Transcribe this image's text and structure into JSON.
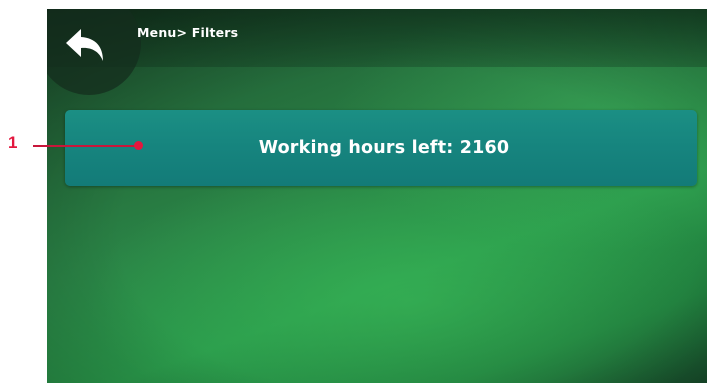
{
  "header": {
    "breadcrumb": "Menu> Filters",
    "back_icon": "back-arrow-icon"
  },
  "main": {
    "info_text": "Working hours left: 2160"
  },
  "annotation": {
    "callout_number": "1",
    "callout_color": "#e3173e"
  },
  "colors": {
    "background_green": "#2a8446",
    "info_bar": "#16847e",
    "text": "#ffffff"
  }
}
